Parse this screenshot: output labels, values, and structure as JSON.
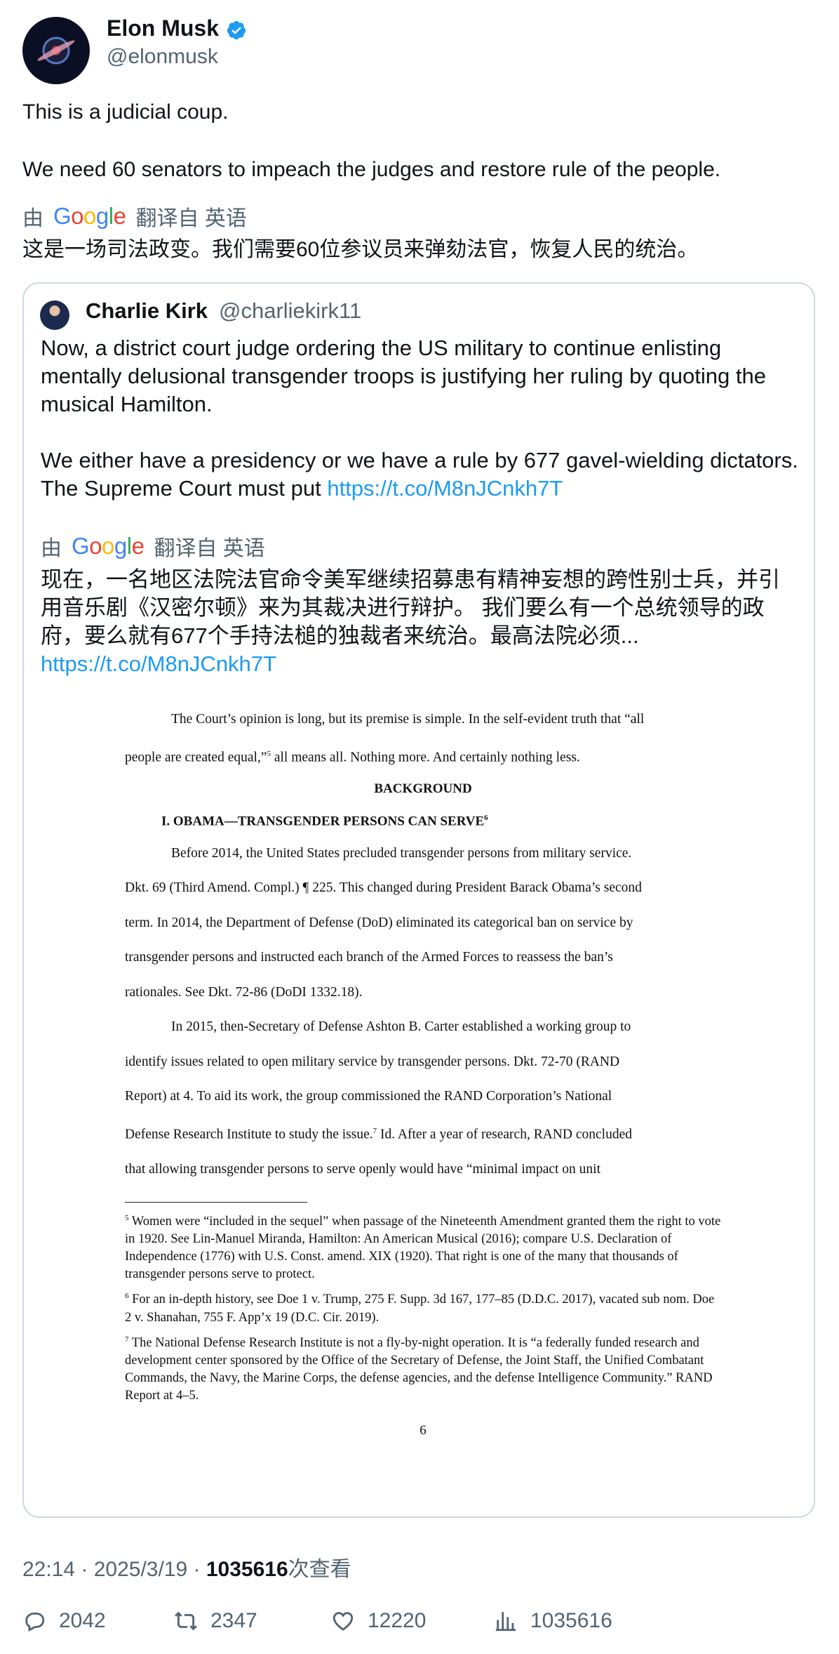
{
  "author": {
    "name": "Elon Musk",
    "handle": "@elonmusk"
  },
  "tweet": {
    "line1": "This is a judicial coup.",
    "line2": "We need 60 senators to impeach the judges and restore rule of the people.",
    "translate_prefix": "由",
    "translate_suffix": "翻译自 英语",
    "translation": "这是一场司法政变。我们需要60位参议员来弹劾法官，恢复人民的统治。"
  },
  "quote": {
    "name": "Charlie Kirk",
    "handle": "@charliekirk11",
    "para1": "Now, a district court judge ordering the US military to continue enlisting mentally delusional transgender troops is justifying her ruling by quoting the musical Hamilton.",
    "para2": "We either have a presidency or we have a rule by 677 gavel-wielding dictators. The Supreme Court must put ",
    "link": "https://t.co/M8nJCnkh7T",
    "translate_prefix": "由",
    "translate_suffix": "翻译自 英语",
    "translation": "现在，一名地区法院法官命令美军继续招募患有精神妄想的跨性别士兵，并引用音乐剧《汉密尔顿》来为其裁决进行辩护。 我们要么有一个总统领导的政府，要么就有677个手持法槌的独裁者来统治。最高法院必须...",
    "translation_link": "https://t.co/M8nJCnkh7T"
  },
  "document": {
    "p1a": "The Court’s opinion is long, but its premise is simple.  In the self-evident truth that “all",
    "p1b": "people are created equal,”",
    "p1b_sup": "5",
    "p1b_rest": " all means all.  Nothing more.  And certainly nothing less.",
    "heading": "BACKGROUND",
    "section": "I.     OBAMA—TRANSGENDER PERSONS CAN SERVE",
    "section_sup": "6",
    "p2": [
      "Before 2014, the United States precluded transgender persons from military service.",
      "Dkt. 69 (Third Amend. Compl.) ¶ 225.  This changed during President Barack Obama’s second",
      "term.  In 2014, the Department of Defense (DoD) eliminated its categorical ban on service by",
      "transgender persons and instructed each branch of the Armed Forces to reassess the ban’s",
      "rationales.  See Dkt. 72-86 (DoDI 1332.18)."
    ],
    "p3": [
      "In 2015, then-Secretary of Defense Ashton B. Carter established a working group to",
      "identify issues related to open military service by transgender persons.  Dkt. 72-70 (RAND",
      "Report) at 4.  To aid its work, the group commissioned the RAND Corporation’s National",
      "Defense Research Institute to study the issue.",
      "that allowing transgender persons to serve openly would have “minimal impact on unit"
    ],
    "p3_line4_sup": "7",
    "p3_line4_rest": "  Id.  After a year of research, RAND concluded",
    "fn5_num": "5",
    "fn5": "Women were “included in the sequel” when passage of the Nineteenth Amendment granted them the right to vote in 1920.  See Lin-Manuel Miranda, Hamilton: An American Musical (2016); compare U.S. Declaration of Independence (1776) with U.S. Const. amend. XIX (1920). That right is one of the many that thousands of transgender persons serve to protect.",
    "fn6_num": "6",
    "fn6": "For an in-depth history, see Doe 1 v. Trump, 275 F. Supp. 3d 167, 177–85 (D.D.C. 2017), vacated sub nom. Doe 2 v. Shanahan, 755 F. App’x 19 (D.C. Cir. 2019).",
    "fn7_num": "7",
    "fn7": "The National Defense Research Institute is not a fly-by-night operation.  It is “a federally funded research and development center sponsored by the Office of the Secretary of Defense, the Joint Staff, the Unified Combatant Commands, the Navy, the Marine Corps, the defense agencies, and the defense Intelligence Community.”  RAND Report at 4–5.",
    "page_number": "6"
  },
  "meta": {
    "time": "22:14 · 2025/3/19 · ",
    "views": "1035616",
    "views_suffix": "次查看"
  },
  "actions": {
    "replies": "2042",
    "reposts": "2347",
    "likes": "12220",
    "views": "1035616"
  }
}
